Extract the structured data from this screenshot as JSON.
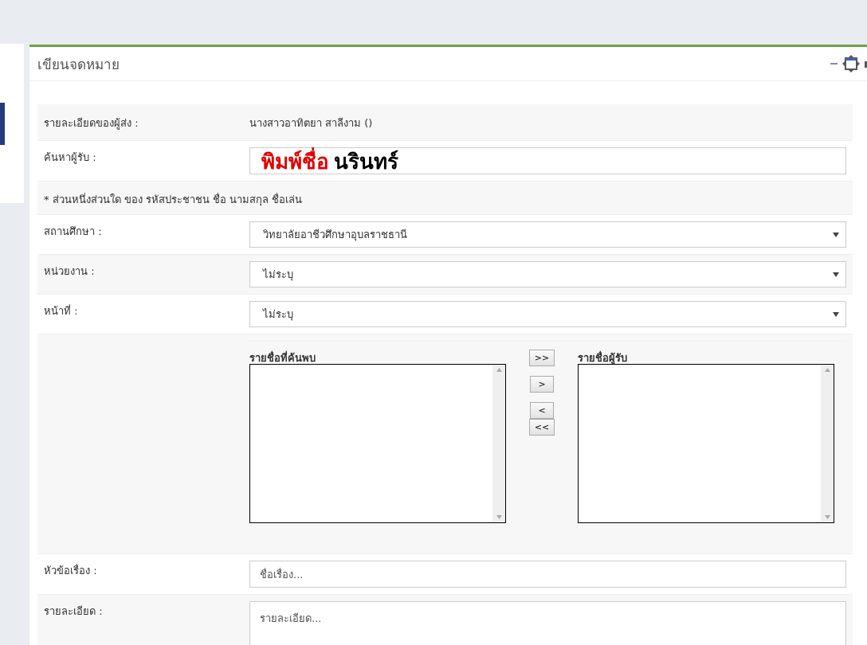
{
  "panel": {
    "title": "เขียนจดหมาย"
  },
  "form": {
    "sender": {
      "label": "รายละเอียดของผู้ส่ง :",
      "value": "นางสาวอาทิตยา สาลีงาม ()"
    },
    "recipient_search": {
      "label": "ค้นหาผู้รับ :",
      "annotation": "พิมพ์ชื่อ",
      "value": "นรินทร์"
    },
    "search_note": "* ส่วนหนึ่งส่วนใด ของ รหัสประชาชน ชื่อ นามสกุล ชื่อเล่น",
    "selects": [
      {
        "label": "สถานศึกษา :",
        "value": "วิทยาลัยอาชีวศึกษาอุบลราชธานี"
      },
      {
        "label": "หน่วยงาน :",
        "value": "ไม่ระบุ"
      },
      {
        "label": "หน้าที่ :",
        "value": "ไม่ระบุ"
      }
    ],
    "lists": {
      "found_title": "รายชื่อที่ค้นพบ",
      "recipients_title": "รายชื่อผู้รับ",
      "buttons": [
        ">>",
        ">",
        "<",
        "<<"
      ]
    },
    "subject": {
      "label": "หัวข้อเรื่อง :",
      "placeholder": "ชื่อเรื่อง..."
    },
    "details": {
      "label": "รายละเอียด :",
      "placeholder": "รายละเอียด..."
    }
  }
}
